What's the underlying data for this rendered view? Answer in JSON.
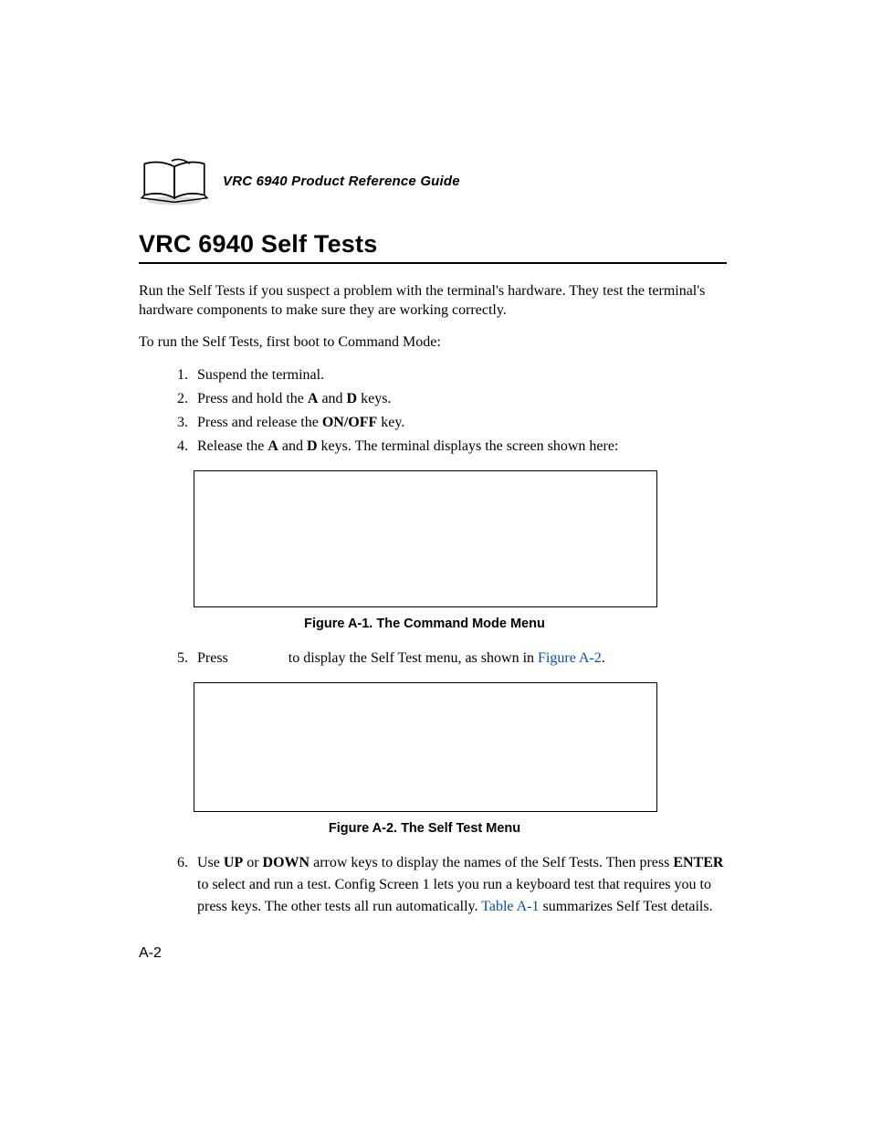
{
  "header": {
    "running_head": "VRC 6940 Product Reference Guide"
  },
  "section": {
    "title": "VRC 6940 Self Tests",
    "intro_p1": "Run the Self Tests if you suspect a problem with the terminal's hardware. They test the terminal's hardware components to make sure they are working correctly.",
    "intro_p2": "To run the Self Tests, first boot to Command Mode:"
  },
  "steps": {
    "s1": "Suspend the terminal.",
    "s2_pre": "Press and hold the ",
    "s2_key1": "A",
    "s2_mid": " and ",
    "s2_key2": "D",
    "s2_post": " keys.",
    "s3_pre": "Press and release the ",
    "s3_key": "ON/OFF",
    "s3_post": " key.",
    "s4_pre": "Release the ",
    "s4_key1": "A",
    "s4_mid": " and ",
    "s4_key2": "D",
    "s4_post": " keys. The terminal displays the screen shown here:",
    "s5_pre": "Press ",
    "s5_mid": " to display the Self Test menu, as shown in ",
    "s5_figref": "Figure A-2",
    "s5_post": ".",
    "s6_pre": "Use ",
    "s6_key1": "UP",
    "s6_mid1": " or ",
    "s6_key2": "DOWN",
    "s6_mid2": " arrow keys to display the names of the Self Tests. Then press ",
    "s6_key3": "ENTER",
    "s6_mid3": " to select and run a test. Config Screen 1 lets you run a keyboard test that requires you to press keys. The other tests all run automatically.  ",
    "s6_tableref": "Table A-1",
    "s6_post": " summarizes Self Test details."
  },
  "figures": {
    "f1_caption": "Figure A-1.  The Command Mode Menu",
    "f2_caption": "Figure A-2.  The Self Test Menu"
  },
  "page_number": "A-2"
}
